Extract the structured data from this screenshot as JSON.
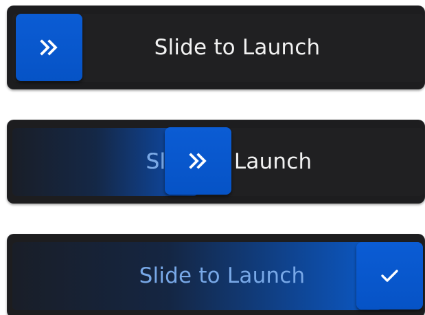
{
  "sliders": [
    {
      "label": "Slide to Launch",
      "state": "idle",
      "progress": 0,
      "thumb_icon": "double-chevron-right-icon"
    },
    {
      "label": "Slide to Launch",
      "state": "dragging",
      "progress": 0.42,
      "thumb_icon": "double-chevron-right-icon"
    },
    {
      "label": "Slide to Launch",
      "state": "complete",
      "progress": 1,
      "thumb_icon": "checkmark-icon"
    }
  ],
  "colors": {
    "background": "#ffffff",
    "track": "#1d1d1f",
    "thumb": "#0653c6",
    "label": "#f2f2f2",
    "label_active": "#78a8e7"
  }
}
